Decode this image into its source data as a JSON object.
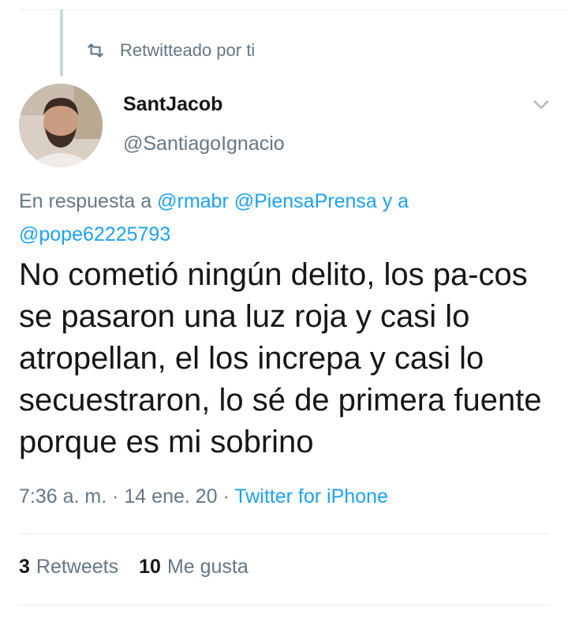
{
  "retweet": {
    "label": "Retwitteado por ti",
    "icon": "retweet-icon"
  },
  "author": {
    "name": "SantJacob",
    "handle": "@SantiagoIgnacio",
    "avatar_icon": "avatar"
  },
  "reply_to": {
    "prefix": "En respuesta a",
    "mention_1": "@rmabr",
    "mention_2": "@PiensaPrensa",
    "joiner": "y a",
    "mention_3": "@pope62225793"
  },
  "tweet": {
    "text": "No cometió ningún delito, los pa-cos se pasaron una luz roja y casi lo atropellan, el los increpa y casi lo secuestraron, lo sé de primera fuente porque es mi sobrino",
    "time": "7:36 a. m.",
    "separator": "·",
    "date": "14 ene. 20",
    "source": "Twitter for iPhone"
  },
  "stats": {
    "retweets_count": "3",
    "retweets_label": "Retweets",
    "likes_count": "10",
    "likes_label": "Me gusta"
  },
  "colors": {
    "accent": "#1da1f2",
    "secondary_text": "#657786",
    "primary_text": "#14171a",
    "divider": "#e6ecf0"
  }
}
